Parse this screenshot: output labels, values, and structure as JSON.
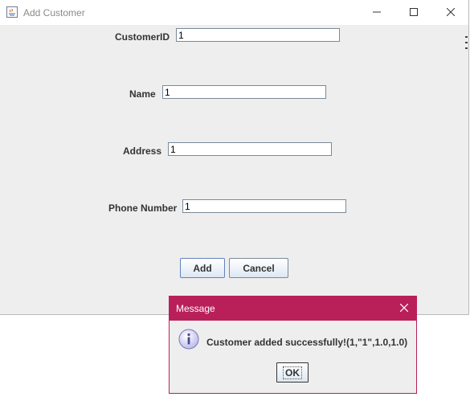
{
  "window": {
    "title": "Add Customer",
    "controls": {
      "minimize_icon": "minimize-icon",
      "maximize_icon": "maximize-icon",
      "close_icon": "close-icon"
    }
  },
  "form": {
    "fields": [
      {
        "label": "CustomerID",
        "value": "1"
      },
      {
        "label": "Name",
        "value": "1"
      },
      {
        "label": "Address",
        "value": "1"
      },
      {
        "label": "Phone Number",
        "value": "1"
      }
    ],
    "add_label": "Add",
    "cancel_label": "Cancel"
  },
  "dialog": {
    "title": "Message",
    "message": "Customer added successfully!(1,\"1\",1.0,1.0)",
    "ok_label": "OK",
    "icon": "info-icon"
  },
  "colors": {
    "window_bg": "#eeeeee",
    "dialog_accent": "#b9205a",
    "button_gradient_bottom": "#dde8f3"
  }
}
